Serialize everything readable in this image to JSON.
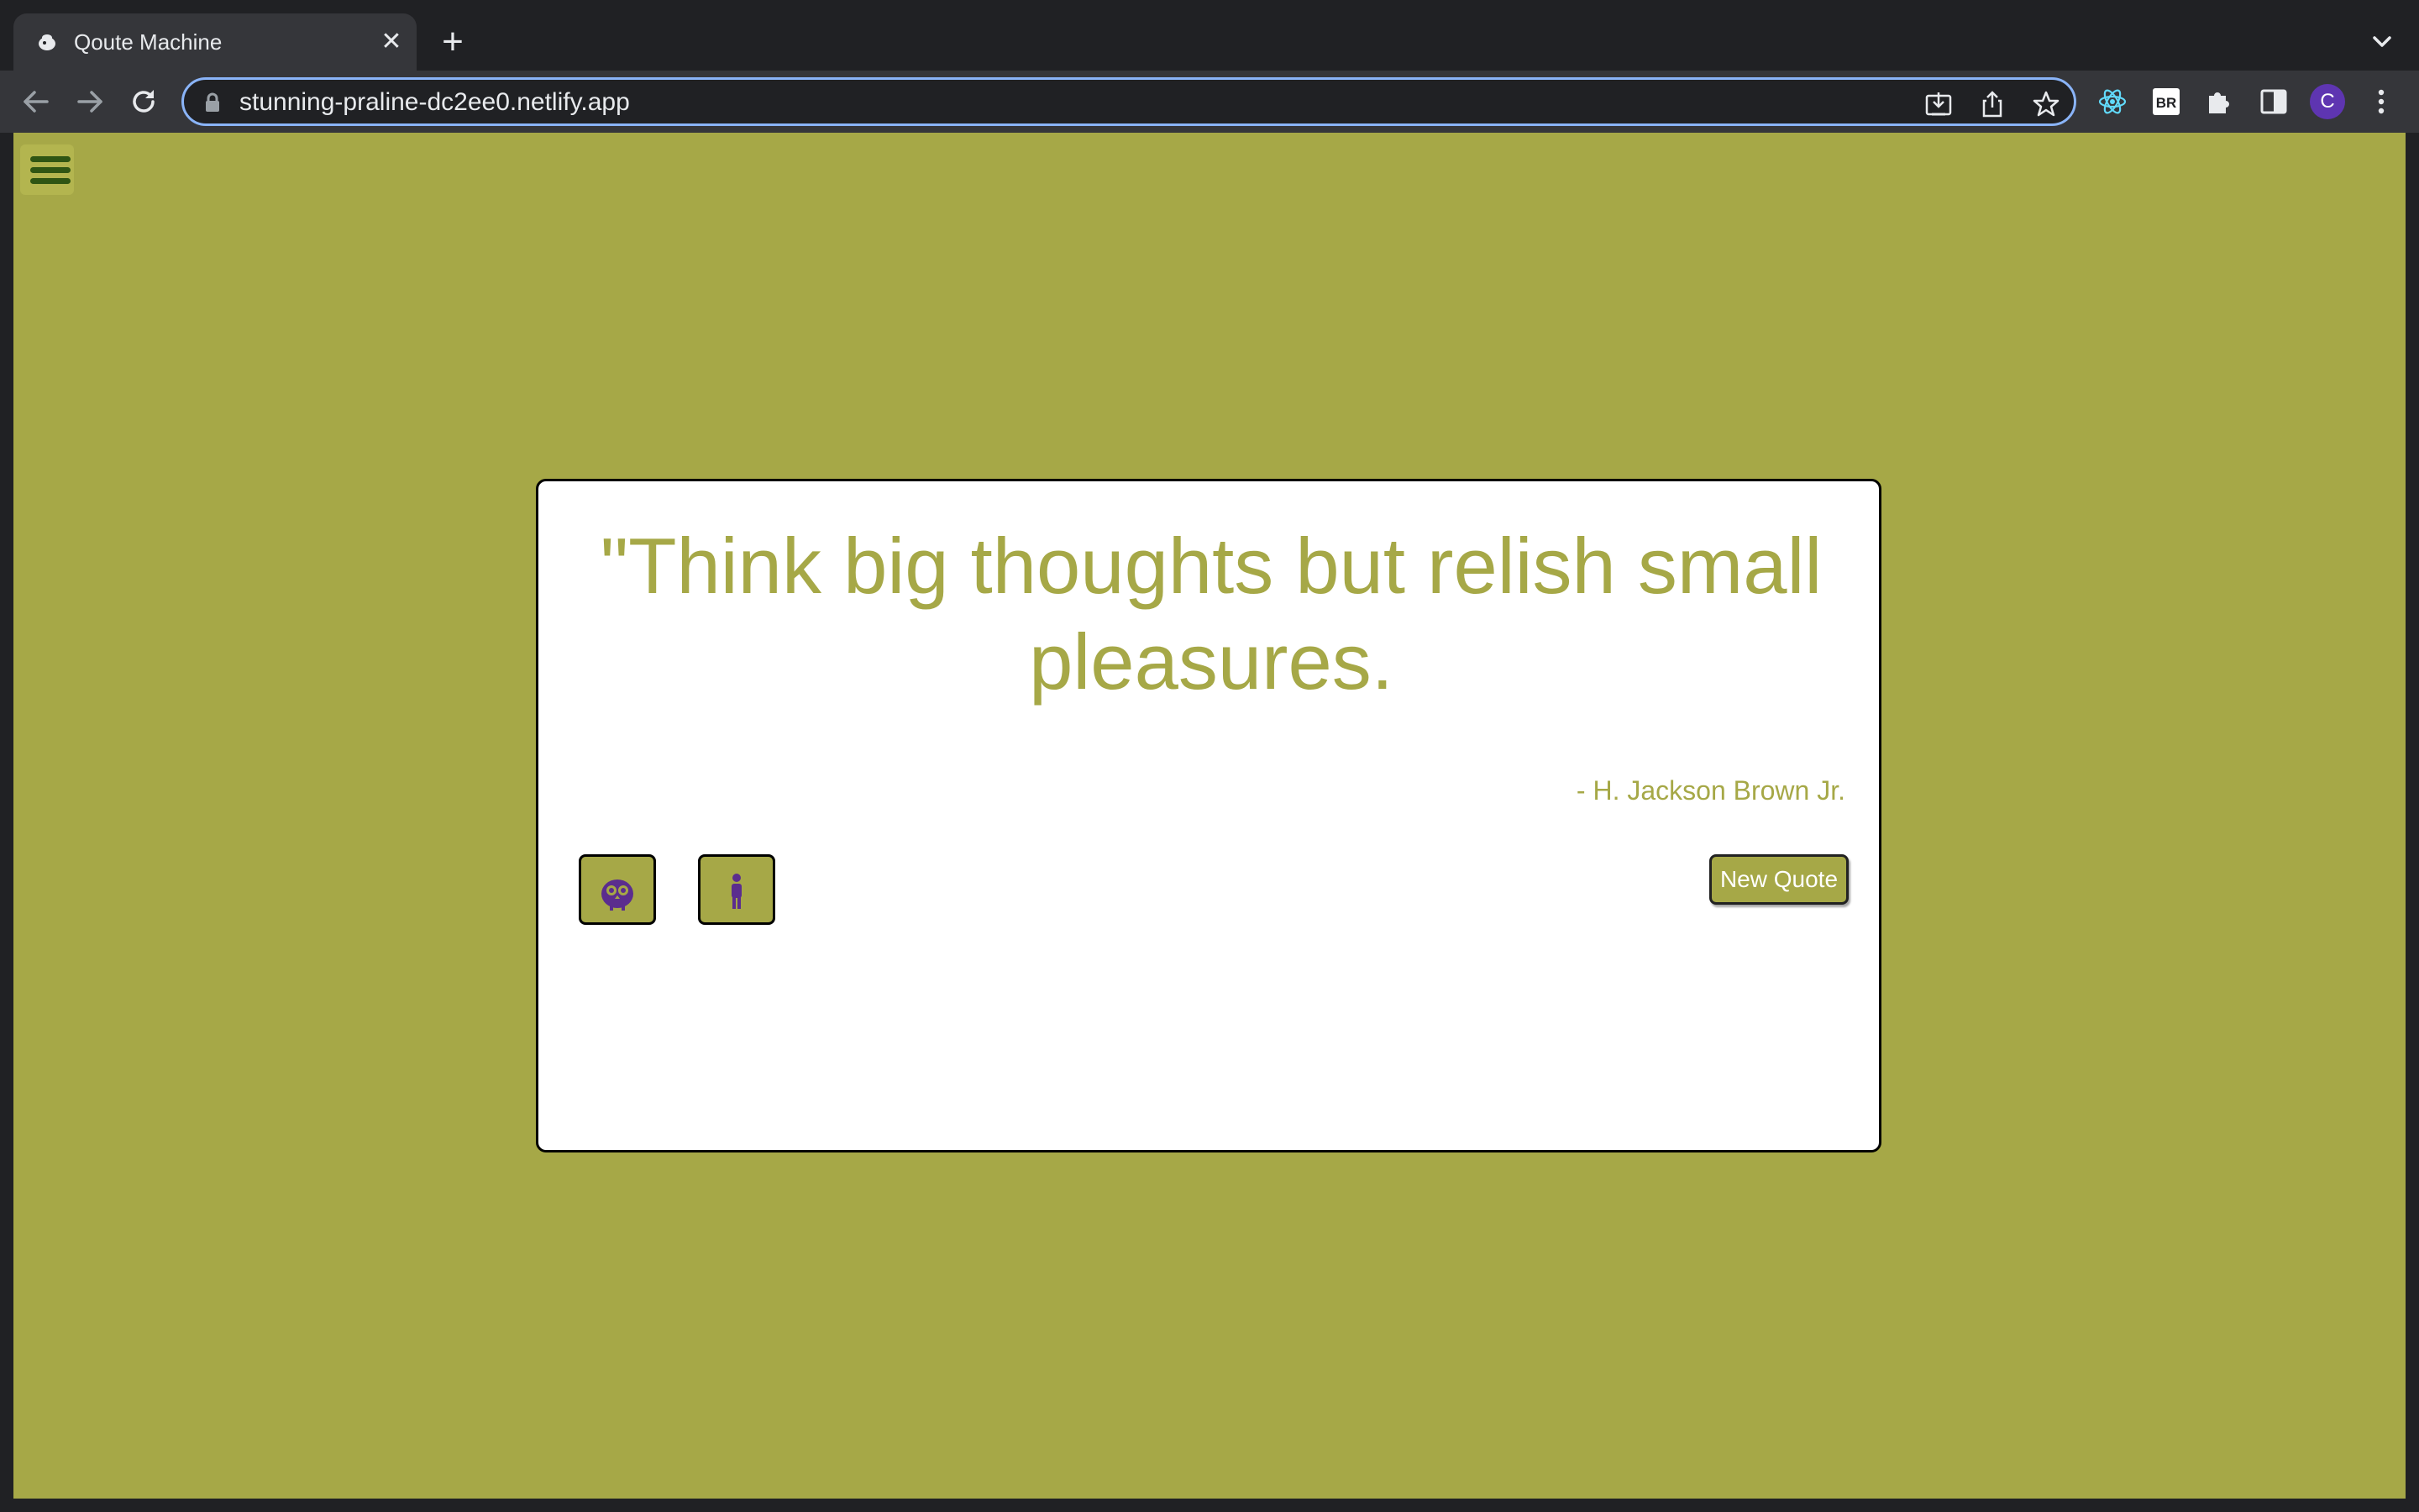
{
  "browser": {
    "tab_title": "Qoute Machine",
    "tab_close": "✕",
    "new_tab": "+",
    "url": "stunning-praline-dc2ee0.netlify.app",
    "profile_initial": "C",
    "extension_br_label": "BR",
    "icons": [
      "favicon-icon",
      "back-icon",
      "forward-icon",
      "reload-icon",
      "lock-icon",
      "install-icon",
      "share-icon",
      "bookmark-star-icon",
      "react-devtools-icon",
      "br-extension-icon",
      "extensions-puzzle-icon",
      "side-panel-icon",
      "menu-kebab-icon",
      "tab-dropdown-icon"
    ]
  },
  "page": {
    "background_color": "#a6a847",
    "accent_color": "#a6a847",
    "quote_text": "\"Think big thoughts but relish small pleasures.",
    "author": "- H. Jackson Brown Jr.",
    "new_quote_label": "New Quote",
    "icons": [
      "hamburger-menu-icon",
      "tumblr-owl-icon",
      "person-icon"
    ]
  }
}
